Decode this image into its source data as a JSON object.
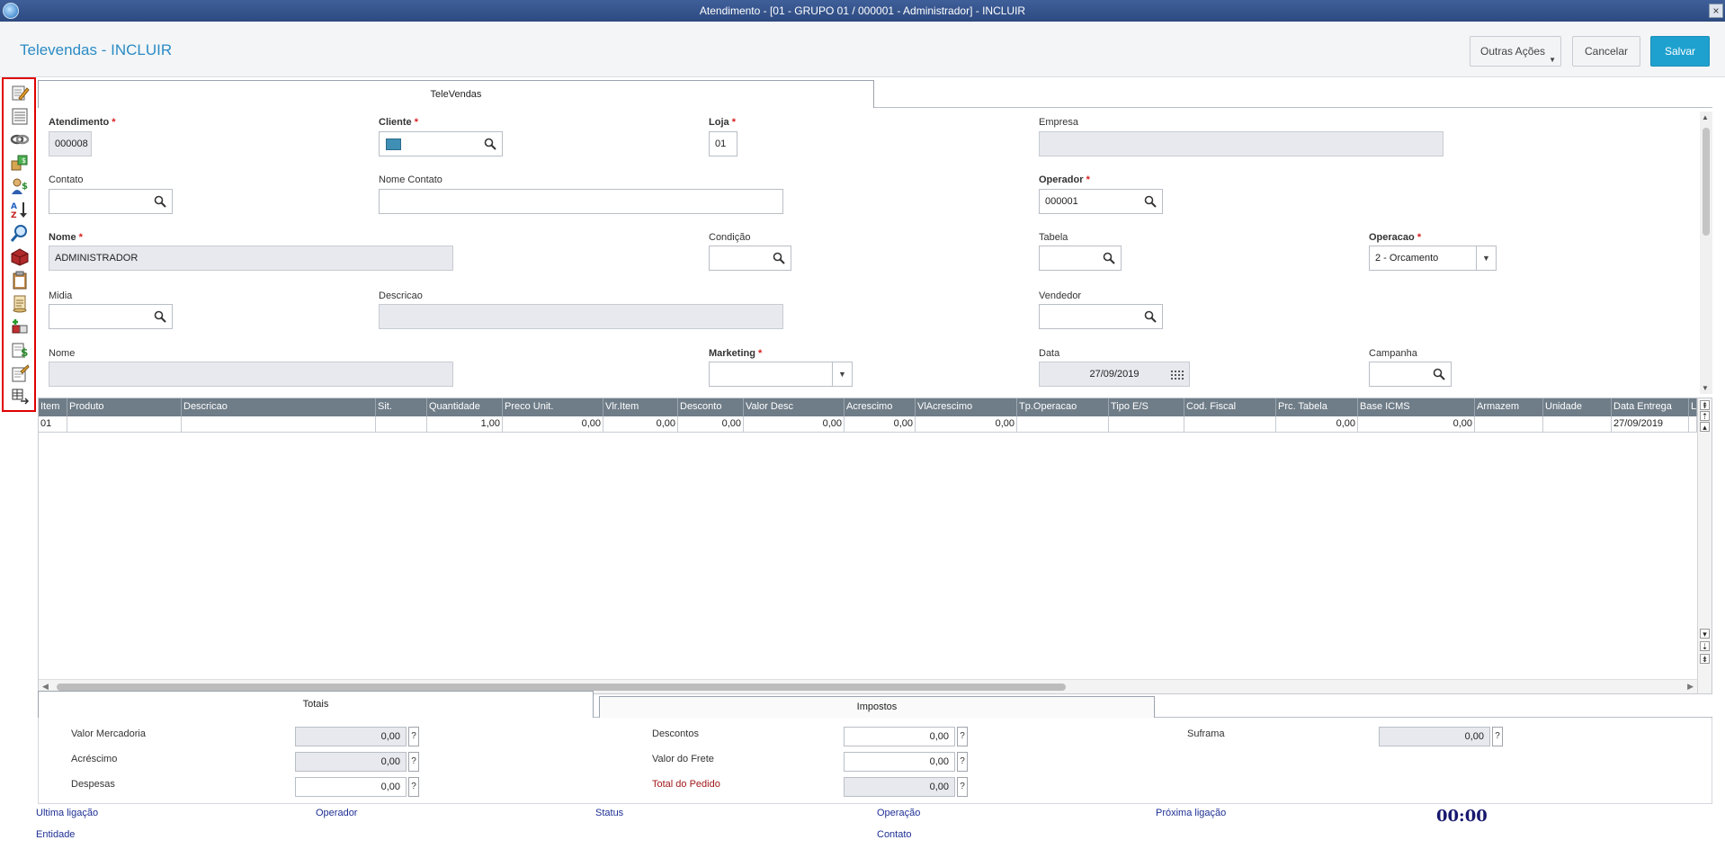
{
  "window": {
    "title": "Atendimento - [01 - GRUPO 01 / 000001 - Administrador] - INCLUIR",
    "close": "×"
  },
  "header": {
    "title": "Televendas - INCLUIR",
    "outras_acoes": "Outras Ações",
    "cancelar": "Cancelar",
    "salvar": "Salvar"
  },
  "toolbar": {
    "items": [
      "edit-icon",
      "list-icon",
      "chain-icon",
      "products-icon",
      "users-money-icon",
      "sort-icon",
      "search-icon",
      "box-icon",
      "clipboard-icon",
      "scroll-icon",
      "gift-box-icon",
      "money-doc-icon",
      "notes-icon",
      "grid-arrow-icon"
    ]
  },
  "tabs": {
    "televendas": "TeleVendas"
  },
  "form": {
    "atendimento": {
      "label": "Atendimento",
      "value": "000008"
    },
    "cliente": {
      "label": "Cliente",
      "value": ""
    },
    "loja": {
      "label": "Loja",
      "value": "01"
    },
    "empresa": {
      "label": "Empresa",
      "value": ""
    },
    "contato": {
      "label": "Contato",
      "value": ""
    },
    "nome_contato": {
      "label": "Nome Contato",
      "value": ""
    },
    "operador": {
      "label": "Operador",
      "value": "000001"
    },
    "nome": {
      "label": "Nome",
      "value": "ADMINISTRADOR"
    },
    "condicao": {
      "label": "Condição",
      "value": ""
    },
    "tabela": {
      "label": "Tabela",
      "value": ""
    },
    "operacao": {
      "label": "Operacao",
      "value": "2 - Orcamento"
    },
    "midia": {
      "label": "Midia",
      "value": ""
    },
    "descricao": {
      "label": "Descricao",
      "value": ""
    },
    "vendedor": {
      "label": "Vendedor",
      "value": ""
    },
    "nome2": {
      "label": "Nome",
      "value": ""
    },
    "marketing": {
      "label": "Marketing",
      "value": ""
    },
    "data": {
      "label": "Data",
      "value": "27/09/2019"
    },
    "campanha": {
      "label": "Campanha",
      "value": ""
    }
  },
  "grid": {
    "columns": [
      "Item",
      "Produto",
      "Descricao",
      "Sit.",
      "Quantidade",
      "Preco Unit.",
      "Vlr.Item",
      "Desconto",
      "Valor Desc",
      "Acrescimo",
      "VlAcrescimo",
      "Tp.Operacao",
      "Tipo E/S",
      "Cod. Fiscal",
      "Prc. Tabela",
      "Base ICMS",
      "Armazem",
      "Unidade",
      "Data Entrega",
      "Lo"
    ],
    "rows": [
      [
        "01",
        "",
        "",
        "",
        "1,00",
        "0,00",
        "0,00",
        "0,00",
        "0,00",
        "0,00",
        "0,00",
        "",
        "",
        "",
        "0,00",
        "0,00",
        "",
        "",
        "27/09/2019",
        ""
      ]
    ]
  },
  "bottom_tabs": {
    "totais": "Totais",
    "impostos": "Impostos"
  },
  "totals": {
    "valor_mercadoria": {
      "label": "Valor Mercadoria",
      "value": "0,00"
    },
    "acrescimo": {
      "label": "Acréscimo",
      "value": "0,00"
    },
    "despesas": {
      "label": "Despesas",
      "value": "0,00"
    },
    "descontos": {
      "label": "Descontos",
      "value": "0,00"
    },
    "valor_frete": {
      "label": "Valor do Frete",
      "value": "0,00"
    },
    "total_pedido": {
      "label": "Total do Pedido",
      "value": "0,00"
    },
    "suframa": {
      "label": "Suframa",
      "value": "0,00"
    },
    "help": "?"
  },
  "status": {
    "ultima_ligacao": "Ultima ligação",
    "operador": "Operador",
    "status": "Status",
    "operacao": "Operação",
    "proxima_ligacao": "Próxima ligação",
    "entidade": "Entidade",
    "contato": "Contato",
    "timer": "00:00"
  },
  "colors": {
    "accent": "#2b8cc4",
    "primary_button": "#1ea1cf",
    "grid_header": "#6f7d88",
    "toolbar_highlight": "#e00000",
    "status_text": "#1e2f94"
  }
}
